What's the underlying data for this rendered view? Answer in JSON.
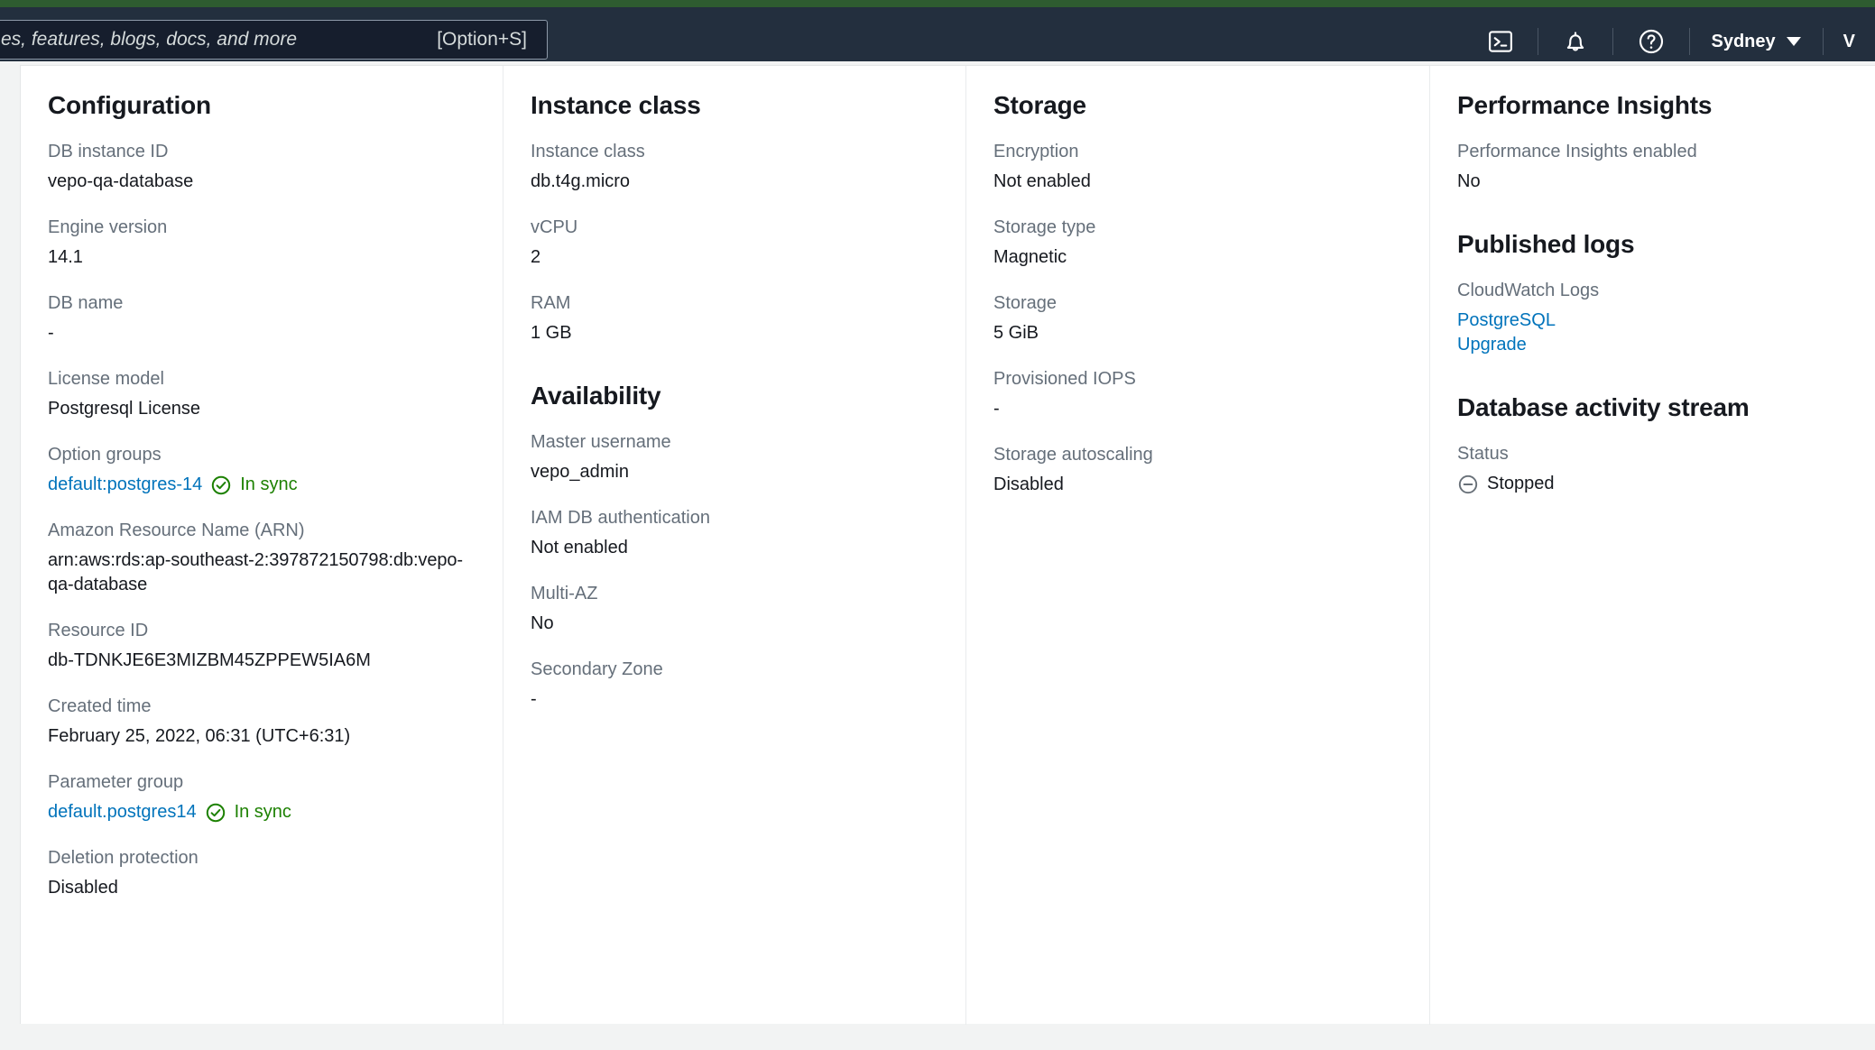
{
  "topbar": {
    "search_placeholder": "es, features, blogs, docs, and more",
    "search_shortcut": "[Option+S]",
    "cloudshell_icon": "cloudshell-terminal-icon",
    "notifications_icon": "bell-icon",
    "help_icon": "question-circle-icon",
    "region": "Sydney",
    "user": "V"
  },
  "colors": {
    "brand_green": "#2e5c30",
    "topbar_bg": "#232f3e",
    "link": "#0073bb",
    "success_green": "#1d8102",
    "label_gray": "#656f7a",
    "value_dark": "#16191f"
  },
  "configuration": {
    "title": "Configuration",
    "fields": [
      {
        "label": "DB instance ID",
        "value": "vepo-qa-database"
      },
      {
        "label": "Engine version",
        "value": "14.1"
      },
      {
        "label": "DB name",
        "value": "-"
      },
      {
        "label": "License model",
        "value": "Postgresql License"
      },
      {
        "label": "Option groups",
        "link": "default:postgres-14",
        "status": "In sync",
        "status_icon": "check-circle-icon"
      },
      {
        "label": "Amazon Resource Name (ARN)",
        "value": "arn:aws:rds:ap-southeast-2:397872150798:db:vepo-qa-database"
      },
      {
        "label": "Resource ID",
        "value": "db-TDNKJE6E3MIZBM45ZPPEW5IA6M"
      },
      {
        "label": "Created time",
        "value": "February 25, 2022, 06:31 (UTC+6:31)"
      },
      {
        "label": "Parameter group",
        "link": "default.postgres14",
        "status": "In sync",
        "status_icon": "check-circle-icon"
      },
      {
        "label": "Deletion protection",
        "value": "Disabled"
      }
    ]
  },
  "instance_class": {
    "title": "Instance class",
    "fields": [
      {
        "label": "Instance class",
        "value": "db.t4g.micro"
      },
      {
        "label": "vCPU",
        "value": "2"
      },
      {
        "label": "RAM",
        "value": "1 GB"
      }
    ]
  },
  "availability": {
    "title": "Availability",
    "fields": [
      {
        "label": "Master username",
        "value": "vepo_admin"
      },
      {
        "label": "IAM DB authentication",
        "value": "Not enabled"
      },
      {
        "label": "Multi-AZ",
        "value": "No"
      },
      {
        "label": "Secondary Zone",
        "value": "-"
      }
    ]
  },
  "storage": {
    "title": "Storage",
    "fields": [
      {
        "label": "Encryption",
        "value": "Not enabled"
      },
      {
        "label": "Storage type",
        "value": "Magnetic"
      },
      {
        "label": "Storage",
        "value": "5 GiB"
      },
      {
        "label": "Provisioned IOPS",
        "value": "-"
      },
      {
        "label": "Storage autoscaling",
        "value": "Disabled"
      }
    ]
  },
  "performance_insights": {
    "title": "Performance Insights",
    "fields": [
      {
        "label": "Performance Insights enabled",
        "value": "No"
      }
    ]
  },
  "published_logs": {
    "title": "Published logs",
    "label": "CloudWatch Logs",
    "links": [
      "PostgreSQL",
      "Upgrade"
    ]
  },
  "database_activity_stream": {
    "title": "Database activity stream",
    "label": "Status",
    "value": "Stopped",
    "status_icon": "minus-circle-icon"
  }
}
